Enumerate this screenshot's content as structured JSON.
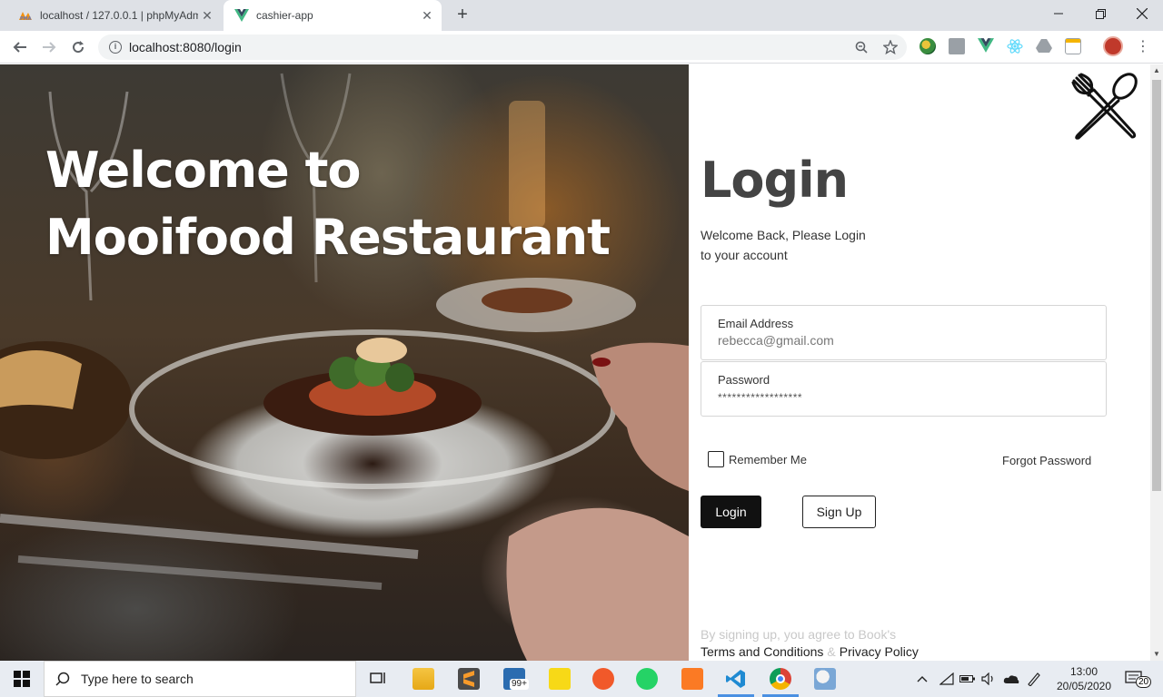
{
  "browser": {
    "tabs": [
      {
        "title": "localhost / 127.0.0.1 | phpMyAdm",
        "icon": "phpmyadmin-icon",
        "active": false
      },
      {
        "title": "cashier-app",
        "icon": "vue-icon",
        "active": true
      }
    ],
    "url": "localhost:8080/login"
  },
  "hero": {
    "line1": "Welcome to",
    "line2": "Mooifood Restaurant"
  },
  "login": {
    "title": "Login",
    "subtitle_line1": "Welcome Back, Please Login",
    "subtitle_line2": "to your account",
    "email_label": "Email Address",
    "email_value": "rebecca@gmail.com",
    "password_label": "Password",
    "password_value": "******************",
    "remember_label": "Remember Me",
    "remember_checked": false,
    "forgot_label": "Forgot Password",
    "login_button": "Login",
    "signup_button": "Sign Up",
    "agree_text": "By signing up, you agree to Book's",
    "terms_link": "Terms and Conditions",
    "amp": "&",
    "privacy_link": "Privacy Policy"
  },
  "taskbar": {
    "search_placeholder": "Type here to search",
    "mail_badge": "99+",
    "time": "13:00",
    "date": "20/05/2020",
    "notification_count": "20"
  }
}
